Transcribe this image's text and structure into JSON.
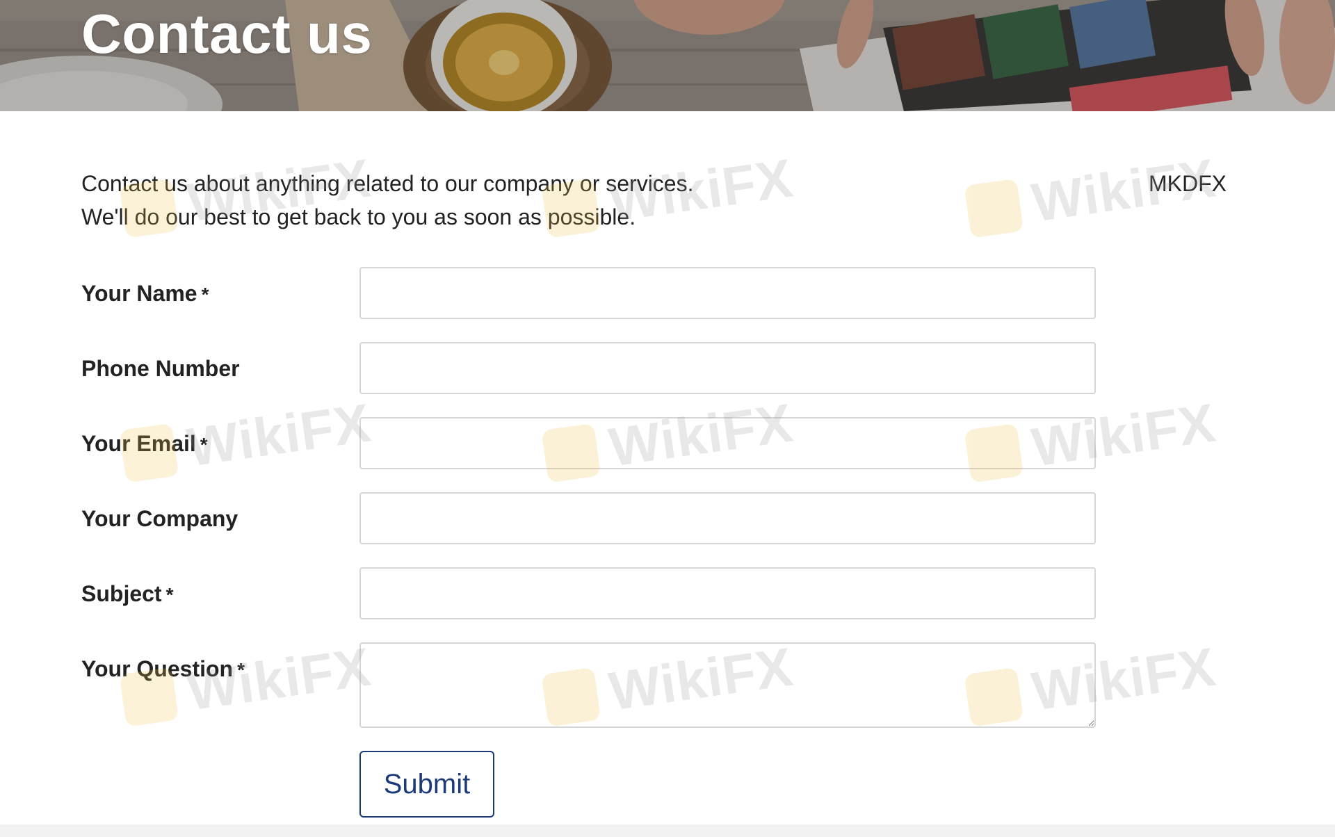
{
  "hero": {
    "title": "Contact us"
  },
  "intro": {
    "line1": "Contact us about anything related to our company or services.",
    "line2": "We'll do our best to get back to you as soon as possible."
  },
  "brand": "MKDFX",
  "form": {
    "name_label": "Your Name",
    "phone_label": "Phone Number",
    "email_label": "Your Email",
    "company_label": "Your Company",
    "subject_label": "Subject",
    "question_label": "Your Question",
    "required_mark": "*",
    "name_value": "",
    "phone_value": "",
    "email_value": "",
    "company_value": "",
    "subject_value": "",
    "question_value": "",
    "submit_label": "Submit"
  },
  "watermark": {
    "text": "WikiFX",
    "logo_color": "#f1c24c"
  },
  "colors": {
    "button_accent": "#1b3a7a",
    "input_border": "#d6d6d6"
  }
}
